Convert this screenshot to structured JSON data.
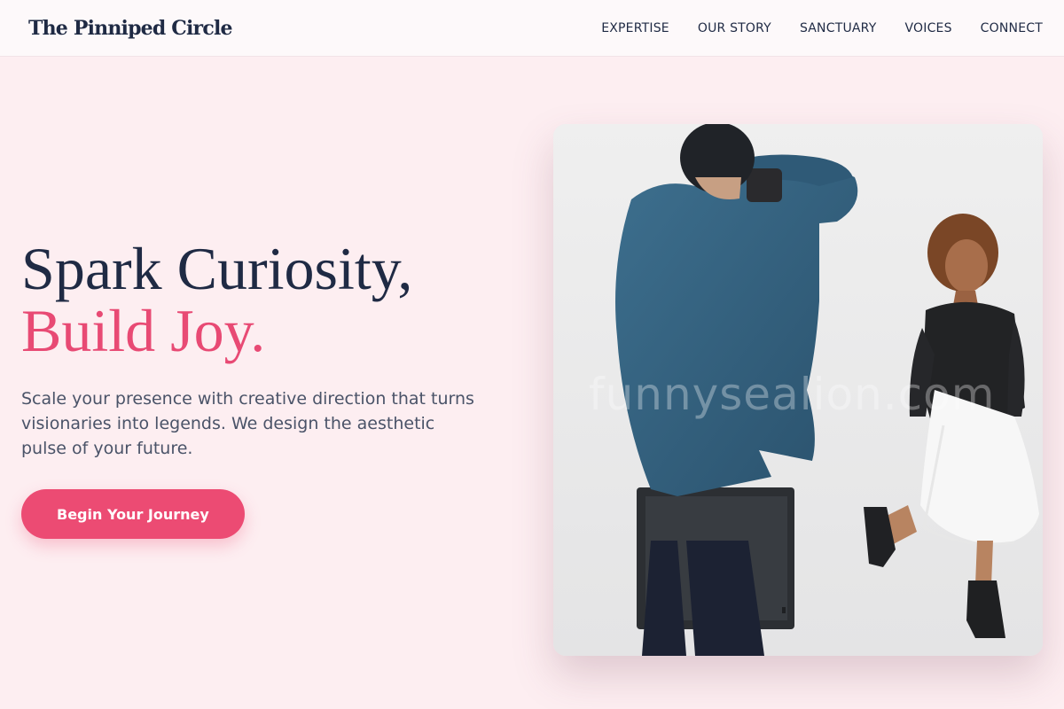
{
  "brand": {
    "logo": "The Pinniped Circle"
  },
  "nav": {
    "items": [
      {
        "label": "EXPERTISE"
      },
      {
        "label": "OUR STORY"
      },
      {
        "label": "SANCTUARY"
      },
      {
        "label": "VOICES"
      },
      {
        "label": "CONNECT"
      }
    ]
  },
  "hero": {
    "headline_line1": "Spark Curiosity,",
    "headline_line2": "Build Joy.",
    "subtext": "Scale your presence with creative direction that turns visionaries into legends. We design the aesthetic pulse of your future.",
    "cta_label": "Begin Your Journey"
  },
  "photo": {
    "watermark": "funnysealion.com"
  },
  "colors": {
    "page_background": "#fdeef1",
    "accent": "#ec4b73",
    "heading": "#1f2a44",
    "body_text": "#4a5368"
  }
}
